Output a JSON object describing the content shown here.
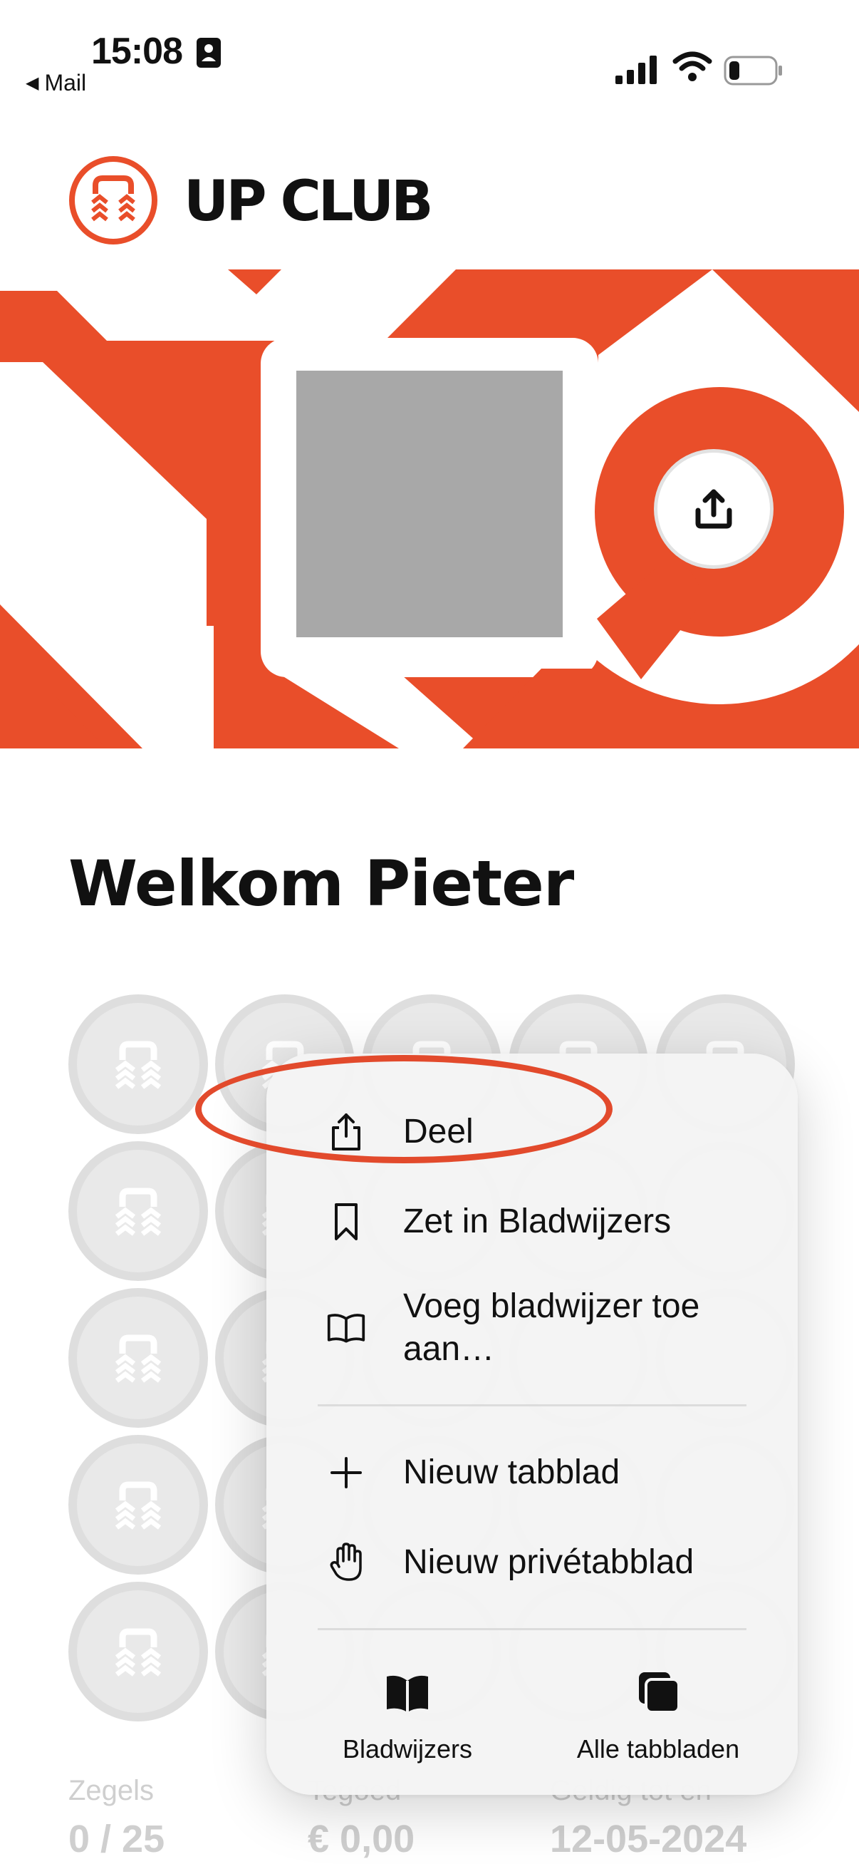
{
  "status_bar": {
    "time": "15:08",
    "back_label": "Mail"
  },
  "header": {
    "brand": "UP CLUB"
  },
  "colors": {
    "brand_orange": "#e94e2a",
    "stamp_gray": "#dedede",
    "menu_bg": "#f4f4f4",
    "annotation_red": "#e24a2c"
  },
  "hero": {
    "share_icon": "share-icon"
  },
  "welcome": "Welkom Pieter",
  "stamps": {
    "rows": 5,
    "cols": 5
  },
  "stats": [
    {
      "label": "Zegels",
      "value": "0 / 25"
    },
    {
      "label": "Tegoed",
      "value": "€ 0,00"
    },
    {
      "label": "Geldig tot en",
      "value": "12-05-2024"
    }
  ],
  "context_menu": {
    "items": [
      {
        "label": "Deel",
        "icon": "share-icon"
      },
      {
        "label": "Zet in Bladwijzers",
        "icon": "bookmark-icon"
      },
      {
        "label": "Voeg bladwijzer toe aan…",
        "icon": "book-icon"
      },
      {
        "label": "Nieuw tabblad",
        "icon": "plus-icon"
      },
      {
        "label": "Nieuw privétabblad",
        "icon": "hand-icon"
      }
    ],
    "bottom": [
      {
        "label": "Bladwijzers",
        "icon": "bookmarks-icon"
      },
      {
        "label": "Alle tabbladen",
        "icon": "tabs-icon"
      }
    ]
  }
}
